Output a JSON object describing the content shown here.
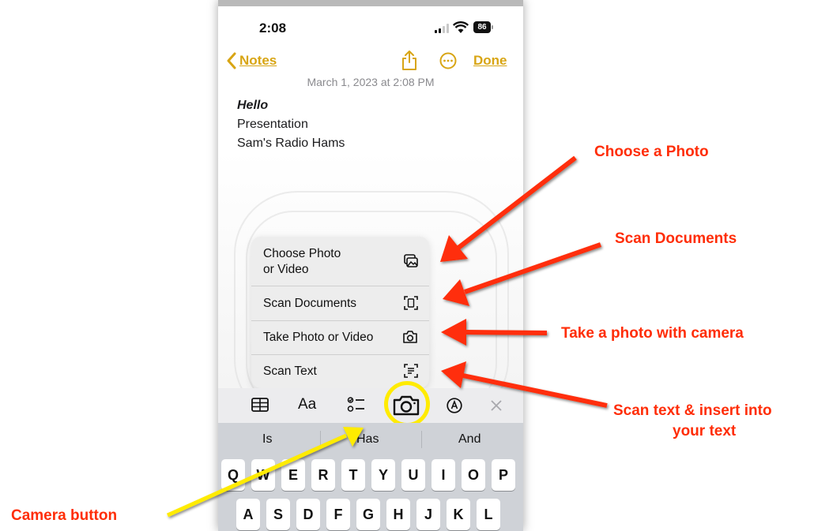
{
  "status_bar": {
    "time": "2:08",
    "battery": "86"
  },
  "nav": {
    "back_label": "Notes",
    "done_label": "Done"
  },
  "note": {
    "date": "March 1, 2023 at 2:08 PM",
    "lines": [
      "Hello",
      "Presentation",
      "Sam's Radio Hams"
    ]
  },
  "menu": {
    "items": [
      {
        "label_line1": "Choose Photo",
        "label_line2": "or Video",
        "icon": "photo-library-icon"
      },
      {
        "label": "Scan Documents",
        "icon": "document-scan-icon"
      },
      {
        "label": "Take Photo or Video",
        "icon": "camera-icon"
      },
      {
        "label": "Scan Text",
        "icon": "text-scan-icon"
      }
    ]
  },
  "toolbar": {
    "format_label": "Aa",
    "icons": [
      "table-icon",
      "format-text-icon",
      "checklist-icon",
      "camera-icon",
      "markup-icon",
      "close-icon"
    ]
  },
  "suggestions": [
    "Is",
    "Has",
    "And"
  ],
  "keyboard": {
    "row1": [
      "Q",
      "W",
      "E",
      "R",
      "T",
      "Y",
      "U",
      "I",
      "O",
      "P"
    ],
    "row2": [
      "A",
      "S",
      "D",
      "F",
      "G",
      "H",
      "J",
      "K",
      "L"
    ]
  },
  "annotations": {
    "choose_photo": "Choose a Photo",
    "scan_documents": "Scan Documents",
    "take_photo": "Take a photo with camera",
    "scan_text_line1": "Scan text & insert into",
    "scan_text_line2": "your text",
    "camera_button": "Camera button"
  },
  "colors": {
    "accent": "#d8a514",
    "annotation": "#ff2d07",
    "highlight": "#ffeb00",
    "pointer_arrow": "#ffeb00"
  }
}
